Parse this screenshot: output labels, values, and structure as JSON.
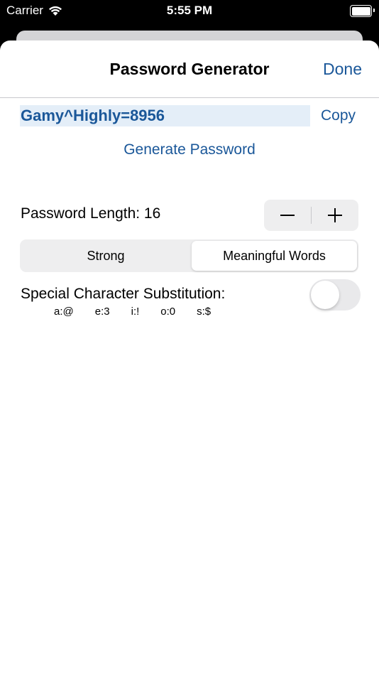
{
  "status_bar": {
    "carrier": "Carrier",
    "time": "5:55 PM",
    "icons": [
      "wifi-icon",
      "battery-icon"
    ]
  },
  "nav": {
    "title": "Password Generator",
    "done_label": "Done"
  },
  "password": {
    "value": "Gamy^Highly=8956",
    "copy_label": "Copy",
    "generate_label": "Generate Password"
  },
  "length": {
    "label": "Password Length: 16",
    "decrement_icon": "minus-icon",
    "increment_icon": "plus-icon"
  },
  "mode": {
    "options": [
      "Strong",
      "Meaningful Words"
    ],
    "selected": "Meaningful Words"
  },
  "substitution": {
    "label": "Special Character Substitution:",
    "enabled": false,
    "pairs": [
      "a:@",
      "e:3",
      "i:!",
      "o:0",
      "s:$"
    ]
  },
  "colors": {
    "accent": "#1a5799",
    "field_bg": "#e4eef8"
  }
}
